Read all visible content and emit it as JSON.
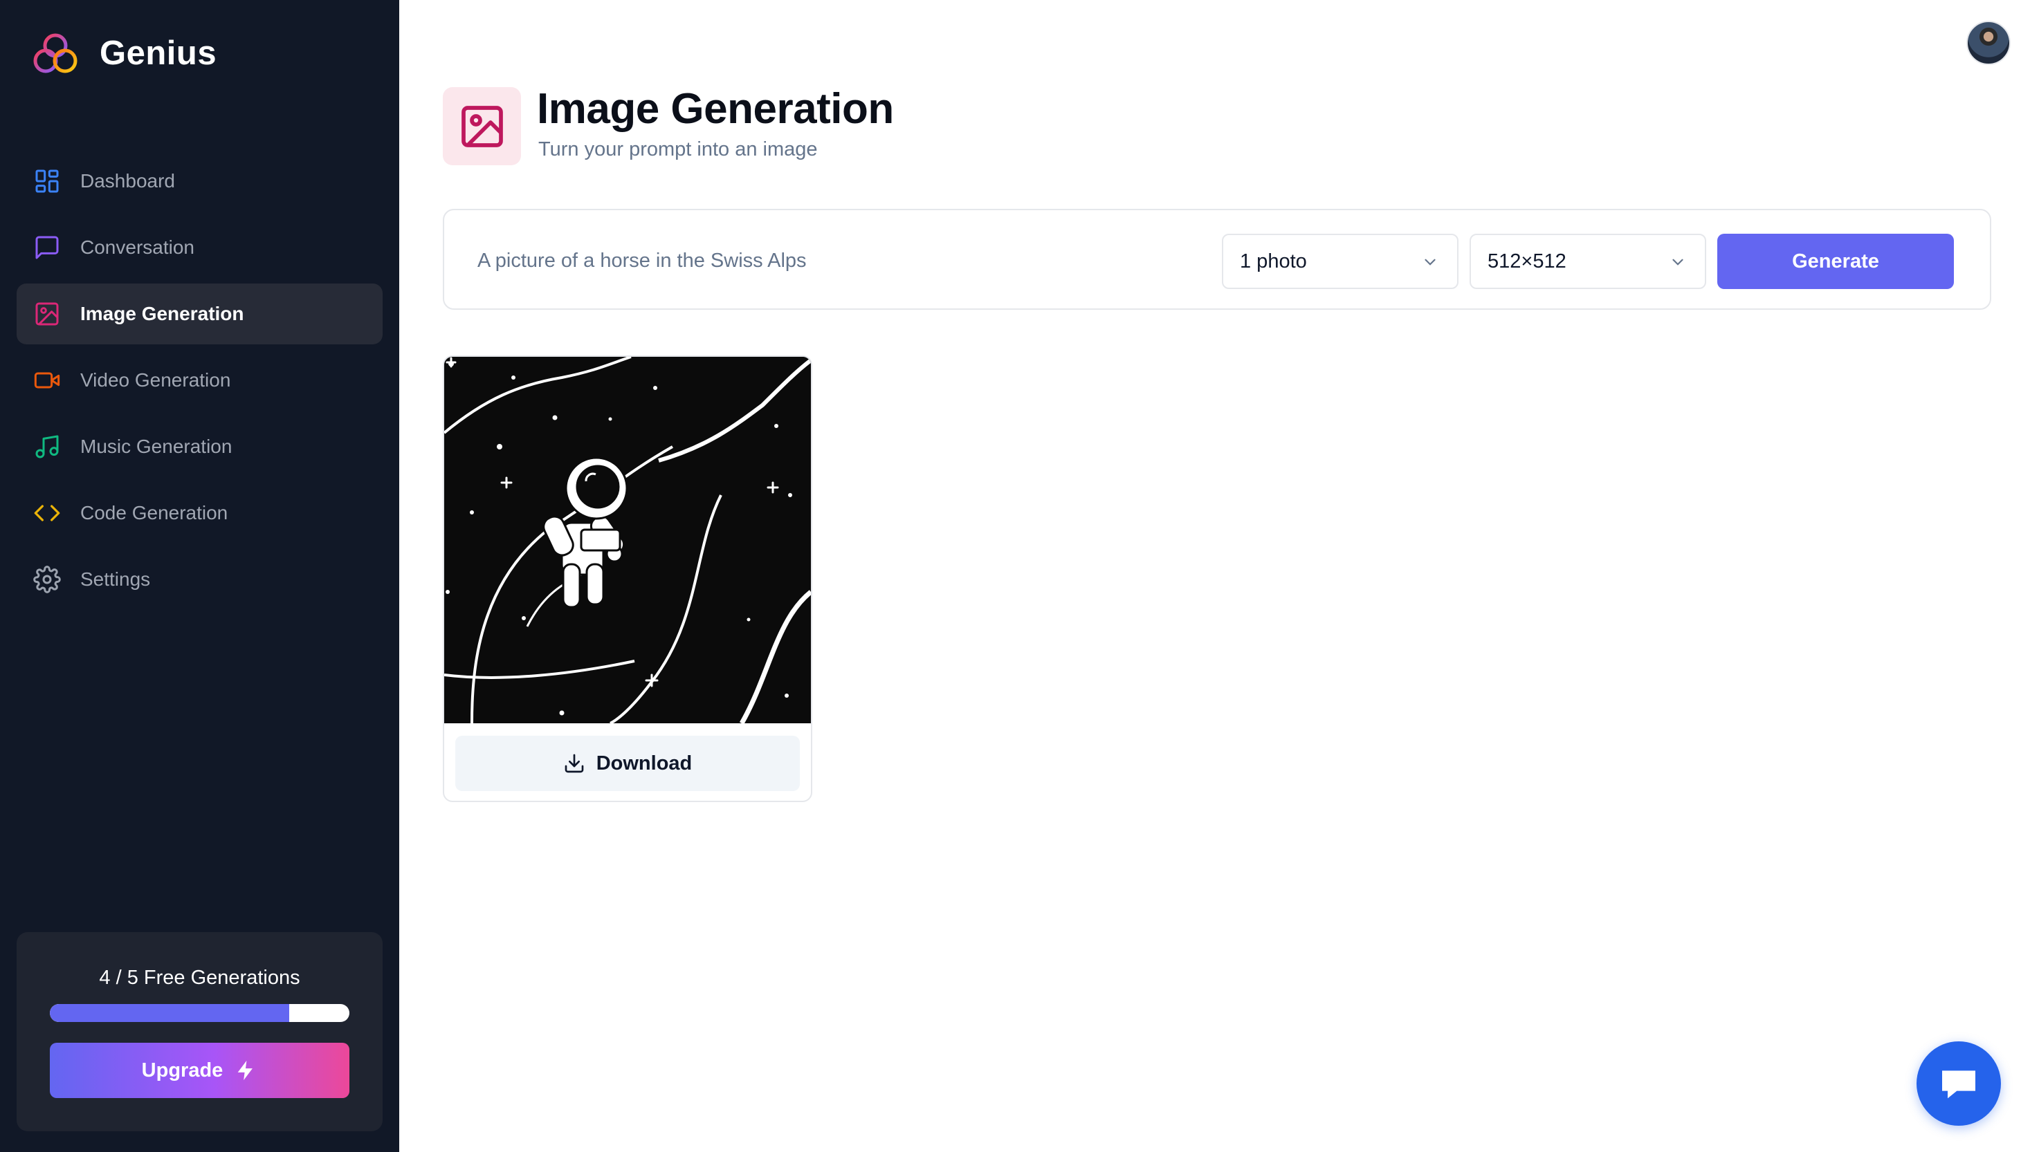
{
  "app": {
    "name": "Genius"
  },
  "sidebar": {
    "items": [
      {
        "label": "Dashboard",
        "icon": "layout-dashboard-icon",
        "color": "#3b82f6",
        "active": false
      },
      {
        "label": "Conversation",
        "icon": "message-square-icon",
        "color": "#8b5cf6",
        "active": false
      },
      {
        "label": "Image Generation",
        "icon": "image-icon",
        "color": "#db2777",
        "active": true
      },
      {
        "label": "Video Generation",
        "icon": "video-icon",
        "color": "#ea580c",
        "active": false
      },
      {
        "label": "Music Generation",
        "icon": "music-icon",
        "color": "#10b981",
        "active": false
      },
      {
        "label": "Code Generation",
        "icon": "code-icon",
        "color": "#eab308",
        "active": false
      },
      {
        "label": "Settings",
        "icon": "settings-icon",
        "color": "#9ca3af",
        "active": false
      }
    ],
    "counter": {
      "text": "4 / 5 Free Generations",
      "used": 4,
      "limit": 5,
      "progress_fraction": 0.8
    },
    "upgrade_label": "Upgrade"
  },
  "header": {
    "title": "Image Generation",
    "subtitle": "Turn your prompt into an image",
    "icon": "image-icon",
    "accent": "#be185d"
  },
  "form": {
    "prompt_placeholder": "A picture of a horse in the Swiss Alps",
    "prompt_value": "",
    "amount_selected": "1 photo",
    "resolution_selected": "512×512",
    "generate_label": "Generate"
  },
  "results": [
    {
      "image": "astronaut-illustration",
      "download_label": "Download"
    }
  ],
  "colors": {
    "primary": "#6366f1",
    "sidebar_bg": "#111827",
    "chat_button": "#2563eb"
  }
}
